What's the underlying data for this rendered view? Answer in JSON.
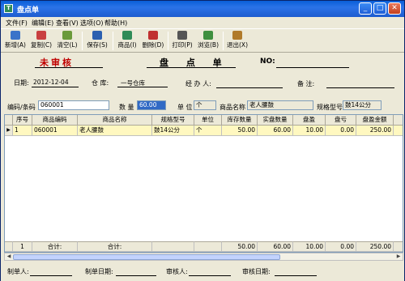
{
  "window": {
    "icon": "T",
    "title": "盘点单"
  },
  "menu": [
    "文件(F)",
    "编辑(E)",
    "查看(V)",
    "选项(O)",
    "帮助(H)"
  ],
  "toolbar": [
    {
      "label": "新增(A)",
      "icon": "new-doc-icon",
      "color": "#3a73c9"
    },
    {
      "label": "复制(C)",
      "icon": "copy-icon",
      "color": "#c94040"
    },
    {
      "label": "清空(L)",
      "icon": "clear-icon",
      "color": "#6a9a3a"
    },
    {
      "label": "保存(S)",
      "icon": "save-icon",
      "color": "#2a5fb0"
    },
    {
      "label": "商品(I)",
      "icon": "product-icon",
      "color": "#2e8b57"
    },
    {
      "label": "删除(D)",
      "icon": "delete-icon",
      "color": "#c03030"
    },
    {
      "label": "打印(P)",
      "icon": "print-icon",
      "color": "#555555"
    },
    {
      "label": "浏览(B)",
      "icon": "browse-icon",
      "color": "#3f8f3f"
    },
    {
      "label": "退出(X)",
      "icon": "exit-icon",
      "color": "#b07a2a"
    }
  ],
  "form": {
    "status": "未审核",
    "title": "盘 点 单",
    "no_label": "NO:",
    "date_label": "日期:",
    "date_value": "2012-12-04",
    "warehouse_label": "仓  库:",
    "warehouse_value": "一号仓库",
    "handler_label": "经 办 人:",
    "remark_label": "备   注:"
  },
  "entry": {
    "barcode_label": "编码/条码",
    "barcode_value": "060001",
    "qty_label": "数  量",
    "qty_value": "60.00",
    "unit_label": "单 位",
    "unit_value": "个",
    "name_label": "商品名称",
    "name_value": "老人腰鼓",
    "spec_label": "规格型号",
    "spec_value": "鼓14公分"
  },
  "grid": {
    "columns": [
      "序号",
      "商品编码",
      "商品名称",
      "规格型号",
      "单位",
      "库存数量",
      "实盘数量",
      "盘盈",
      "盘亏",
      "盘盈金额",
      "盘亏"
    ],
    "rows": [
      {
        "marker": "▶",
        "seq": "1",
        "code": "060001",
        "name": "老人腰鼓",
        "spec": "鼓14公分",
        "unit": "个",
        "stock": "50.00",
        "actual": "60.00",
        "gain": "10.00",
        "loss": "0.00",
        "gain_amount": "250.00"
      }
    ],
    "footer": {
      "seq": "1",
      "label1": "合计:",
      "label2": "合计:",
      "stock": "50.00",
      "actual": "60.00",
      "gain": "10.00",
      "loss": "0.00",
      "gain_amount": "250.00"
    }
  },
  "bottom": {
    "maker_label": "制单人:",
    "make_date_label": "制单日期:",
    "auditor_label": "审核人:",
    "audit_date_label": "审核日期:"
  }
}
